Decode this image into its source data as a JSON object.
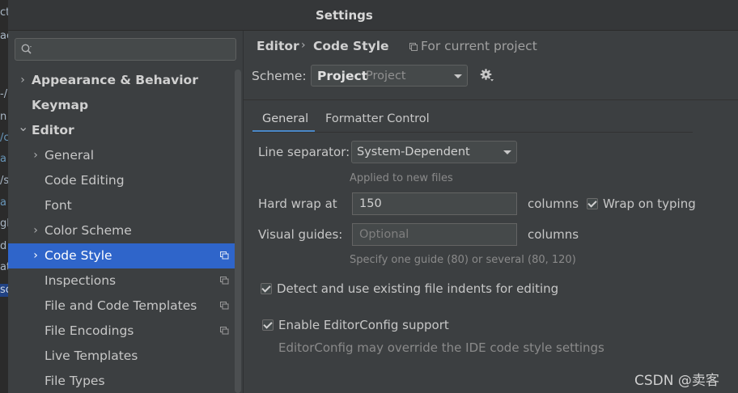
{
  "window": {
    "title": "Settings"
  },
  "background_fragments": [
    "ct",
    "ac",
    "-/",
    "n",
    "/c",
    "a",
    "/s",
    "a",
    "gl",
    "d",
    "at",
    "so"
  ],
  "search": {
    "placeholder": ""
  },
  "sidebar": {
    "items": [
      {
        "label": "Appearance & Behavior",
        "expand": "collapsed",
        "level": 0
      },
      {
        "label": "Keymap",
        "expand": "none",
        "level": 0
      },
      {
        "label": "Editor",
        "expand": "expanded",
        "level": 0
      },
      {
        "label": "General",
        "expand": "collapsed",
        "level": 1
      },
      {
        "label": "Code Editing",
        "expand": "none",
        "level": 1
      },
      {
        "label": "Font",
        "expand": "none",
        "level": 1
      },
      {
        "label": "Color Scheme",
        "expand": "collapsed",
        "level": 1
      },
      {
        "label": "Code Style",
        "expand": "collapsed",
        "level": 1,
        "selected": true,
        "project_icon": true
      },
      {
        "label": "Inspections",
        "expand": "none",
        "level": 1,
        "project_icon": true
      },
      {
        "label": "File and Code Templates",
        "expand": "none",
        "level": 1,
        "project_icon": true
      },
      {
        "label": "File Encodings",
        "expand": "none",
        "level": 1,
        "project_icon": true
      },
      {
        "label": "Live Templates",
        "expand": "none",
        "level": 1
      },
      {
        "label": "File Types",
        "expand": "none",
        "level": 1
      }
    ]
  },
  "breadcrumb": {
    "root": "Editor",
    "separator": "›",
    "current": "Code Style",
    "scope": "For current project"
  },
  "scheme": {
    "label": "Scheme:",
    "name": "Project",
    "kind": "Project"
  },
  "tabs": [
    {
      "label": "General",
      "active": true
    },
    {
      "label": "Formatter Control",
      "active": false
    }
  ],
  "general": {
    "line_separator_label": "Line separator:",
    "line_separator_value": "System-Dependent",
    "line_separator_hint": "Applied to new files",
    "hard_wrap_label": "Hard wrap at",
    "hard_wrap_value": "150",
    "hard_wrap_unit": "columns",
    "wrap_on_typing_label": "Wrap on typing",
    "visual_guides_label": "Visual guides:",
    "visual_guides_placeholder": "Optional",
    "visual_guides_unit": "columns",
    "visual_guides_hint": "Specify one guide (80) or several (80, 120)",
    "detect_indents_label": "Detect and use existing file indents for editing",
    "editorconfig_label": "Enable EditorConfig support",
    "editorconfig_hint": "EditorConfig may override the IDE code style settings"
  },
  "watermark": "CSDN @卖客",
  "colors": {
    "selection": "#2f65ca",
    "tab_underline": "#4a88c7",
    "panel_bg": "#3c3f41"
  }
}
